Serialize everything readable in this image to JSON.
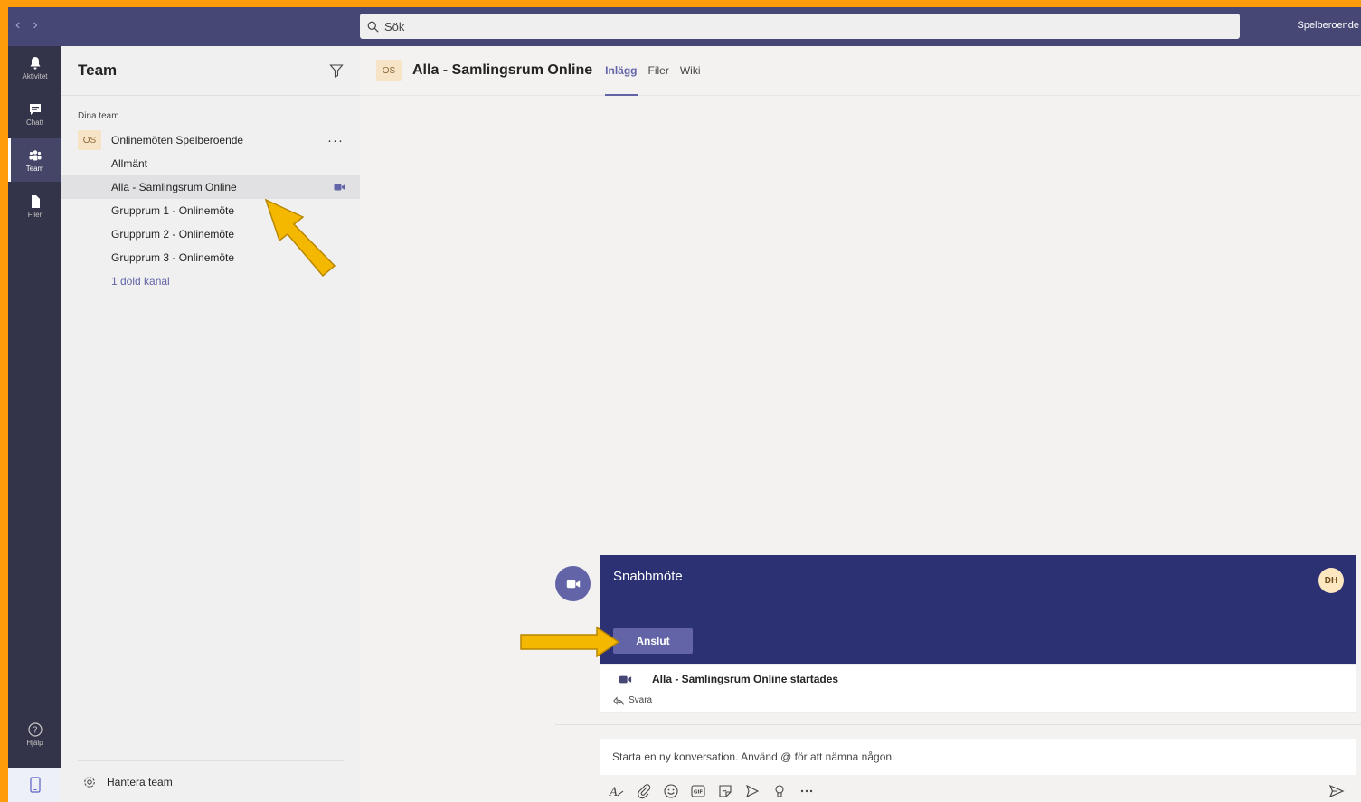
{
  "topbar": {
    "search_placeholder": "Sök",
    "user_label": "Spelberoende"
  },
  "rail": {
    "items": [
      {
        "label": "Aktivitet",
        "icon": "bell-icon"
      },
      {
        "label": "Chatt",
        "icon": "chat-icon"
      },
      {
        "label": "Team",
        "icon": "team-icon"
      },
      {
        "label": "Filer",
        "icon": "file-icon"
      }
    ],
    "help_label": "Hjälp",
    "device_icon": "mobile-icon"
  },
  "panel": {
    "title": "Team",
    "section_label": "Dina team",
    "team": {
      "badge": "OS",
      "name": "Onlinemöten Spelberoende",
      "more": "···"
    },
    "channels": [
      {
        "label": "Allmänt"
      },
      {
        "label": "Alla - Samlingsrum Online"
      },
      {
        "label": "Grupprum 1 - Onlinemöte"
      },
      {
        "label": "Grupprum 2 - Onlinemöte"
      },
      {
        "label": "Grupprum 3 - Onlinemöte"
      }
    ],
    "hidden_channels": "1 dold kanal",
    "manage_team": "Hantera team"
  },
  "main": {
    "badge": "OS",
    "title": "Alla - Samlingsrum Online",
    "tabs": [
      {
        "label": "Inlägg"
      },
      {
        "label": "Filer"
      },
      {
        "label": "Wiki"
      }
    ],
    "meeting": {
      "title": "Snabbmöte",
      "avatar": "DH",
      "join_label": "Anslut",
      "started_text": "Alla - Samlingsrum Online startades",
      "reply_label": "Svara"
    },
    "compose_placeholder": "Starta en ny konversation. Använd @ för att nämna någon."
  },
  "colors": {
    "frame": "#ff9c0a",
    "topbar": "#464775",
    "rail": "#33344a",
    "accent": "#6264a7",
    "meeting_card": "#2b3173",
    "annotation_arrow": "#f5b800"
  }
}
